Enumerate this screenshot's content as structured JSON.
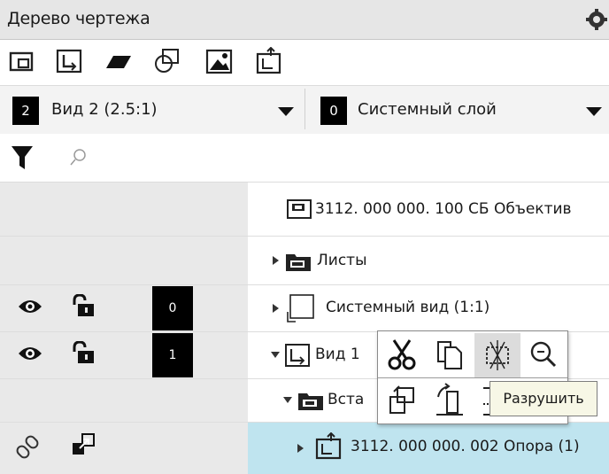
{
  "panel": {
    "title": "Дерево чертежа",
    "settings_icon": "gear-icon"
  },
  "toolbar": {
    "icons": [
      "new-view-icon",
      "local-cs-icon",
      "hatch-icon",
      "insert-fragment-icon",
      "insert-image-icon",
      "insert-view-icon"
    ]
  },
  "view_selector": {
    "number": "2",
    "label": "Вид 2 (2.5:1)"
  },
  "layer_selector": {
    "number": "0",
    "label": "Системный слой"
  },
  "filter": {
    "filter_icon": "filter-icon",
    "search_icon": "search-icon",
    "placeholder": ""
  },
  "tree": {
    "root": {
      "label": "3112. 000 000. 100 СБ Объектив"
    },
    "sheets": {
      "label": "Листы"
    },
    "system_view": {
      "label": "Системный вид (1:1)",
      "layer": "0"
    },
    "view1": {
      "label": "Вид 1",
      "layer": "1"
    },
    "inserts": {
      "label": "Вста"
    },
    "selected": {
      "label": "3112. 000 000. 002 Опора (1)"
    }
  },
  "context_toolbar": {
    "row1": [
      "cut-icon",
      "copy-icon",
      "destroy-icon",
      "zoom-icon"
    ],
    "row2": [
      "edit-in-place-icon",
      "move-icon",
      "break-link-icon"
    ]
  },
  "tooltip": {
    "text": "Разрушить"
  },
  "colors": {
    "selected_row": "#bfe4ef",
    "left_column": "#e9e9e9",
    "header": "#e6e6e6"
  }
}
